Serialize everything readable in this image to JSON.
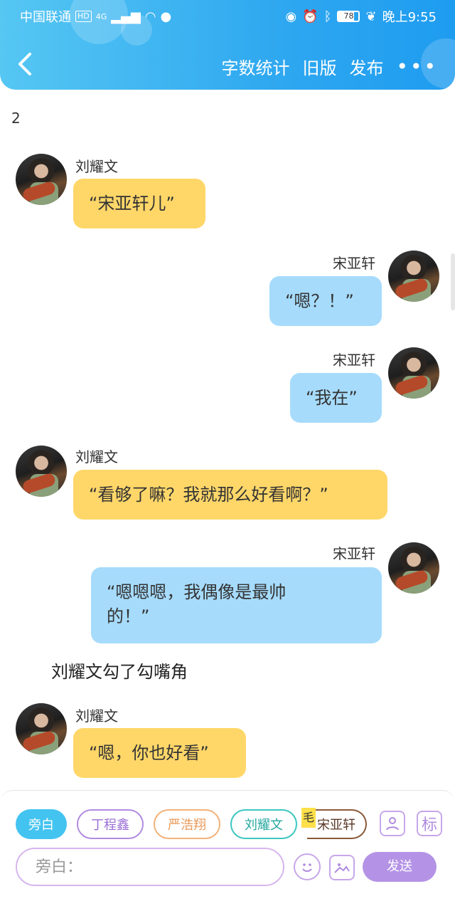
{
  "status_bar": {
    "carrier": "中国联通",
    "hd": "HD",
    "network": "4G",
    "battery": "78",
    "time": "晚上9:55"
  },
  "toolbar": {
    "word_count": "字数统计",
    "old_version": "旧版",
    "publish": "发布"
  },
  "stray_text": "2",
  "messages": [
    {
      "speaker": "刘耀文",
      "text": "“宋亚轩儿”"
    },
    {
      "speaker": "宋亚轩",
      "text": "“嗯？！”"
    },
    {
      "speaker": "宋亚轩",
      "text": "“我在”"
    },
    {
      "speaker": "刘耀文",
      "text": "“看够了嘛？我就那么好看啊？”"
    },
    {
      "speaker": "宋亚轩",
      "text": "“嗯嗯嗯，我偶像是最帅的！”"
    },
    {
      "speaker": "刘耀文",
      "text": "“嗯，你也好看”"
    }
  ],
  "narration": "刘耀文勾了勾嘴角",
  "composer": {
    "chips": [
      "旁白",
      "丁程鑫",
      "严浩翔",
      "刘耀文",
      "宋亚轩"
    ],
    "marker": "毛",
    "tag_button": "标",
    "placeholder": "旁白：",
    "send": "发送"
  },
  "colors": {
    "header": "#2fa8f0",
    "left_bubble": "#ffd769",
    "right_bubble": "#a6dbfb",
    "send_button": "#b493e6"
  }
}
